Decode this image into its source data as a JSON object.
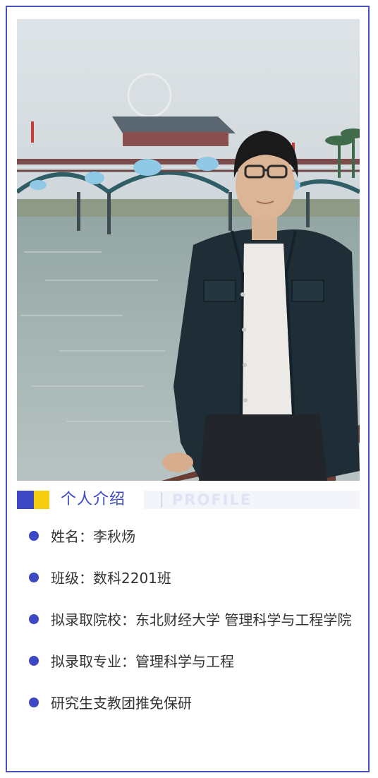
{
  "header": {
    "title_cn": "个人介绍",
    "title_en": "PROFILE"
  },
  "colors": {
    "accent_blue": "#3c48c4",
    "accent_yellow": "#f5cd0f",
    "border": "#4a4fc0"
  },
  "items": [
    {
      "text": "姓名：李秋炀"
    },
    {
      "text": "班级：数科2201班"
    },
    {
      "text": "拟录取院校：东北财经大学 管理科学与工程学院"
    },
    {
      "text": "拟录取专业：管理科学与工程"
    },
    {
      "text": "研究生支教团推免保研"
    }
  ]
}
